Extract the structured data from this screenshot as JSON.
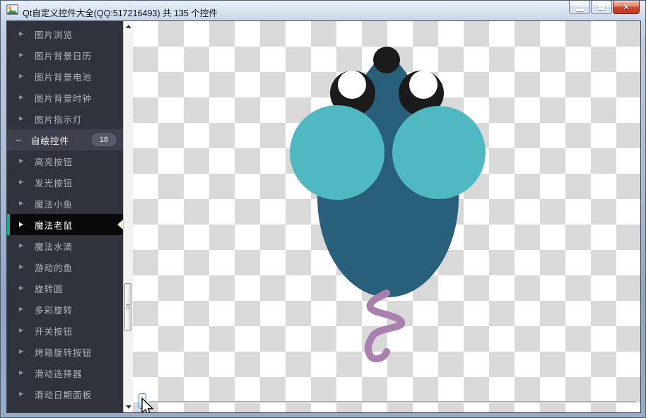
{
  "window": {
    "title": "Qt自定义控件大全(QQ:517216493) 共 135 个控件"
  },
  "icons": {
    "collapsed_arrow": "▶",
    "expanded_minus": "−",
    "close_glyph": "✕"
  },
  "sidebar": {
    "accent_color": "#13ad93",
    "selected_notch_color": "#f2ecd8",
    "items": [
      {
        "label": "图片浏览",
        "type": "parent"
      },
      {
        "label": "图片背景日历",
        "type": "parent"
      },
      {
        "label": "图片背景电池",
        "type": "parent"
      },
      {
        "label": "图片背景时钟",
        "type": "parent"
      },
      {
        "label": "图片指示灯",
        "type": "parent"
      },
      {
        "label": "自绘控件",
        "type": "parent",
        "expanded": true,
        "badge": "18"
      },
      {
        "label": "高亮按钮",
        "type": "child"
      },
      {
        "label": "发光按钮",
        "type": "child"
      },
      {
        "label": "魔法小鱼",
        "type": "child"
      },
      {
        "label": "魔法老鼠",
        "type": "child",
        "selected": true
      },
      {
        "label": "魔法水滴",
        "type": "child"
      },
      {
        "label": "游动的鱼",
        "type": "child"
      },
      {
        "label": "旋转圆",
        "type": "child"
      },
      {
        "label": "多彩旋转",
        "type": "child"
      },
      {
        "label": "开关按钮",
        "type": "child"
      },
      {
        "label": "烤箱旋转按钮",
        "type": "child"
      },
      {
        "label": "滑动选择器",
        "type": "child"
      },
      {
        "label": "滑动日期面板",
        "type": "child"
      }
    ]
  },
  "canvas": {
    "widget": "魔法老鼠",
    "colors": {
      "body": "#28607b",
      "ears": "#4fb8c1",
      "eyes": "#1b1b1b",
      "eye_highlight": "#ffffff",
      "tail": "#aa80ae",
      "checker_light": "#ffffff",
      "checker_dark": "#d9d9d9"
    }
  }
}
